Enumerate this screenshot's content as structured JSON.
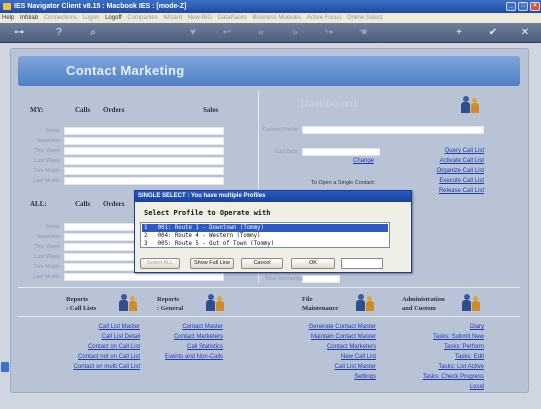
{
  "window": {
    "title": "IES Navigator Client v8.15 : Macbook IES :  [mode-Z]",
    "controls": [
      "minimize",
      "maximize",
      "close"
    ]
  },
  "menubar": {
    "items": [
      {
        "label": "Help",
        "enabled": true
      },
      {
        "label": "Infolab",
        "enabled": true
      },
      {
        "label": "Connections",
        "enabled": false
      },
      {
        "label": "Logon",
        "enabled": false
      },
      {
        "label": "Logoff",
        "enabled": true
      },
      {
        "label": "Companies",
        "enabled": false
      },
      {
        "label": "Wizard",
        "enabled": false
      },
      {
        "label": "New-BIG",
        "enabled": false
      },
      {
        "label": "DataPacks",
        "enabled": false
      },
      {
        "label": "Business Modules",
        "enabled": false
      },
      {
        "label": "Active Focus",
        "enabled": false
      },
      {
        "label": "Online Select",
        "enabled": false
      }
    ]
  },
  "toolbar": {
    "icons": [
      "key-icon",
      "help-icon",
      "search-icon",
      "heart-icon",
      "back-icon",
      "nav-back-icon",
      "nav-forward-icon",
      "forward-icon",
      "hand-icon",
      "add-icon",
      "check-icon",
      "close-icon"
    ]
  },
  "contact": {
    "title": "Contact Marketing"
  },
  "my": {
    "title": "MY:",
    "col_calls": "Calls",
    "col_orders": "Orders",
    "col_sales": "Sales",
    "rows": [
      "Today",
      "Yesterday",
      "This Week",
      "Last Week",
      "This Month",
      "Last Month"
    ]
  },
  "all": {
    "title": "ALL:",
    "col_calls": "Calls",
    "col_orders": "Orders",
    "rows": [
      "Today",
      "Yesterday",
      "This Week",
      "Last Week",
      "This Month",
      "Last Month"
    ]
  },
  "dashboard": {
    "title": "Dashboard",
    "current_profile_label": "Current Profile",
    "call_date_label": "Call Date",
    "change_link": "Change",
    "open_single_label": "To Open a Single Contact:",
    "total_remaining_label": "Total Remaining",
    "links": [
      "Query Call List",
      "Activate Call List",
      "Organize Call List",
      "Execute Call List",
      "Release Call List"
    ]
  },
  "dialog": {
    "title": "SINGLE SELECT : You have multiple Profiles",
    "heading": "Select Profile to Operate with",
    "options": [
      {
        "num": "1",
        "text": "001: Route 1 - Downtown (Tommy)",
        "selected": true
      },
      {
        "num": "2",
        "text": "004: Route 4 - Western (Tommy)",
        "selected": false
      },
      {
        "num": "3",
        "text": "005: Route 5 - Out of Town (Tommy)",
        "selected": false
      }
    ],
    "buttons": {
      "select_all": "Select ALL",
      "show_full_line": "Show Full Line",
      "cancel": "Cancel",
      "ok": "OK"
    },
    "edit_value": ""
  },
  "sections": {
    "reports_calls": {
      "title": "Reports",
      "subtitle": ": Call Lists",
      "links": [
        "Call List Master",
        "Call List Detail",
        "Contact on Call List",
        "Contact not on Call List",
        "Contact on multi Call List"
      ]
    },
    "reports_general": {
      "title": "Reports",
      "subtitle": ": General",
      "links": [
        "Contact Master",
        "Contact Marketers",
        "Call Statistics",
        "Events and Non-Calls"
      ]
    },
    "file_maintenance": {
      "title": "File",
      "subtitle": "Maintenance",
      "links": [
        "Generate Contact Master",
        "Maintain Contact Master",
        "Contact Marketers",
        "New Call List",
        "Call List Master",
        "Settings"
      ]
    },
    "admin": {
      "title": "Administration",
      "subtitle": "and Custom",
      "links": [
        "Diary",
        "Tasks: Submit New",
        "Tasks: Perform",
        "Tasks: Edit",
        "Tasks: List Active",
        "Tasks: Check Progress",
        "Local"
      ]
    }
  }
}
